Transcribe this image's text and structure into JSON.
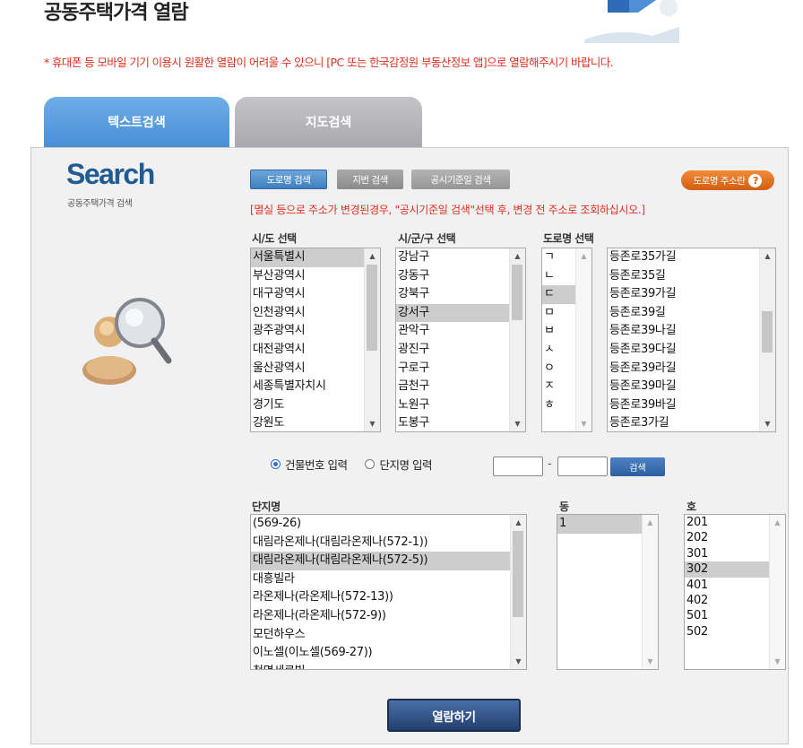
{
  "header": {
    "title": "공동주택가격 열람",
    "notice": "* 휴대폰 등 모바일 기기 이용시 원활한 열람이 어려울 수 있으니 [PC 또는 한국감정원 부동산정보 앱]으로 열람해주시기 바랍니다."
  },
  "tabs": [
    {
      "label": "텍스트검색",
      "active": true
    },
    {
      "label": "지도검색",
      "active": false
    }
  ],
  "side": {
    "logo": "Search",
    "subtitle": "공동주택가격 검색"
  },
  "search_type": {
    "road": "도로명 검색",
    "jibun": "지번 검색",
    "date": "공시기준일 검색",
    "addr_help": "도로명 주소란",
    "help_glyph": "?"
  },
  "warning": "[멸실 등으로 주소가 변경된경우, \"공시기준일 검색\"선택 후, 변경 전 주소로 조회하십시오.]",
  "sido": {
    "label": "시/도 선택",
    "options": [
      "서울특별시",
      "부산광역시",
      "대구광역시",
      "인천광역시",
      "광주광역시",
      "대전광역시",
      "울산광역시",
      "세종특별자치시",
      "경기도",
      "강원도"
    ],
    "selected": "서울특별시"
  },
  "sigungu": {
    "label": "시/군/구 선택",
    "options": [
      "강남구",
      "강동구",
      "강북구",
      "강서구",
      "관악구",
      "광진구",
      "구로구",
      "금천구",
      "노원구",
      "도봉구"
    ],
    "selected": "강서구"
  },
  "road": {
    "label": "도로명 선택",
    "initials": [
      "ㄱ",
      "ㄴ",
      "ㄷ",
      "ㅁ",
      "ㅂ",
      "ㅅ",
      "ㅇ",
      "ㅈ",
      "ㅎ"
    ],
    "selected_initial": "ㄷ",
    "names": [
      "등존로35가길",
      "등존로35길",
      "등존로39가길",
      "등존로39길",
      "등존로39나길",
      "등존로39다길",
      "등존로39라길",
      "등존로39마길",
      "등존로39바길",
      "등존로3가길"
    ]
  },
  "input_mode": {
    "building": "건물번호 입력",
    "complex": "단지명 입력",
    "selected": "building",
    "dash": "-",
    "search": "검색"
  },
  "complex": {
    "label": "단지명",
    "options": [
      "(569-26)",
      "대림라온제나(대림라온제나(572-1))",
      "대림라온제나(대림라온제나(572-5))",
      "대흥빌라",
      "라온제나(라온제나(572-13))",
      "라온제나(라온제나(572-9))",
      "모던하우스",
      "이노셀(이노셀(569-27))",
      "청명세르빌"
    ],
    "selected": "대림라온제나(대림라온제나(572-5))"
  },
  "dong": {
    "label": "동",
    "options": [
      "1"
    ],
    "selected": "1"
  },
  "ho": {
    "label": "호",
    "options": [
      "201",
      "202",
      "301",
      "302",
      "401",
      "402",
      "501",
      "502"
    ],
    "selected": "302"
  },
  "actions": {
    "view": "열람하기"
  },
  "colors": {
    "tab_active": "#5a9ee0",
    "tab_inactive": "#b6b6ba",
    "notice_red": "#e0301e",
    "logo_blue": "#215b94",
    "addr_orange": "#e2731f"
  }
}
